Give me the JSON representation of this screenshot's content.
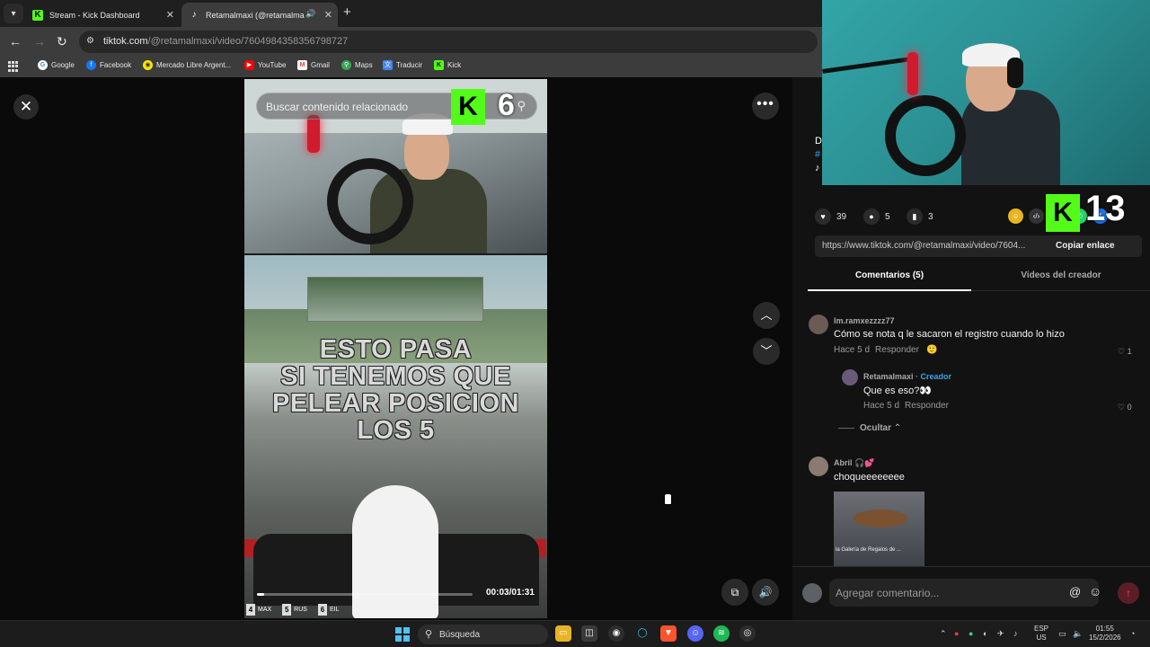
{
  "browser": {
    "tabs": [
      {
        "title": "Stream - Kick Dashboard",
        "favicon": "kick-icon",
        "active": false
      },
      {
        "title": "Retamalmaxi (@retamalmaxi)",
        "favicon": "tiktok-icon",
        "active": true
      }
    ],
    "url_host": "tiktok.com",
    "url_path": "/@retamalmaxi/video/7604984358356798727",
    "bookmarks": [
      {
        "label": "Google",
        "icon": "google-icon",
        "color": "#4285f4"
      },
      {
        "label": "Facebook",
        "icon": "facebook-icon",
        "color": "#1877f2"
      },
      {
        "label": "Mercado Libre Argent...",
        "icon": "mercadolibre-icon",
        "color": "#ffe600"
      },
      {
        "label": "YouTube",
        "icon": "youtube-icon",
        "color": "#ff0000"
      },
      {
        "label": "Gmail",
        "icon": "gmail-icon",
        "color": "#ea4335"
      },
      {
        "label": "Maps",
        "icon": "maps-icon",
        "color": "#34a853"
      },
      {
        "label": "Traducir",
        "icon": "translate-icon",
        "color": "#4285f4"
      },
      {
        "label": "Kick",
        "icon": "kick-icon",
        "color": "#53fc18"
      }
    ]
  },
  "video": {
    "search_placeholder": "Buscar contenido relacionado",
    "kick_badge": "K",
    "kick_count": "6",
    "overlay_lines": [
      "ESTO PASA",
      "SI TENEMOS QUE",
      "PELEAR POSICION",
      "LOS 5"
    ],
    "time": "00:03/01:31",
    "progress_fraction": 0.033,
    "hud": [
      {
        "pos": "4",
        "code": "MAX"
      },
      {
        "pos": "5",
        "code": "RUS"
      },
      {
        "pos": "6",
        "code": "EIL"
      }
    ]
  },
  "panel": {
    "side_letters": {
      "line1": "D",
      "line2": "#",
      "line3": "♪"
    },
    "stats": {
      "likes": "39",
      "comments": "5",
      "saves": "3"
    },
    "kick_badge": "K",
    "kick_count": "13",
    "share_url": "https://www.tiktok.com/@retamalmaxi/video/7604...",
    "copy_label": "Copiar enlace",
    "tab_comments": "Comentarios (5)",
    "tab_creator_videos": "Videos del creador",
    "comments": [
      {
        "user": "lm.ramxezzzz77",
        "text": "Cómo se nota q le sacaron el registro cuando lo hizo",
        "age": "Hace 5 d",
        "reply": "Responder",
        "likes": "1"
      },
      {
        "user": "Retamalmaxi",
        "badge": " · Creador",
        "text": "Que es eso?👀",
        "age": "Hace 5 d",
        "reply": "Responder",
        "likes": "0"
      },
      {
        "user": "Abril 🎧💕",
        "text": "choqueeeeeeee",
        "image_caption": "la Galería de Regalos de ..."
      }
    ],
    "hide_label": "Ocultar",
    "add_comment_placeholder": "Agregar comentario..."
  },
  "taskbar": {
    "search_label": "Búsqueda",
    "lang_line1": "ESP",
    "lang_line2": "US",
    "time": "01:55",
    "date": "15/2/2026"
  },
  "colors": {
    "kick_green": "#53fc18",
    "creator_blue": "#38a6e8",
    "accent_red": "#d01b2f"
  }
}
